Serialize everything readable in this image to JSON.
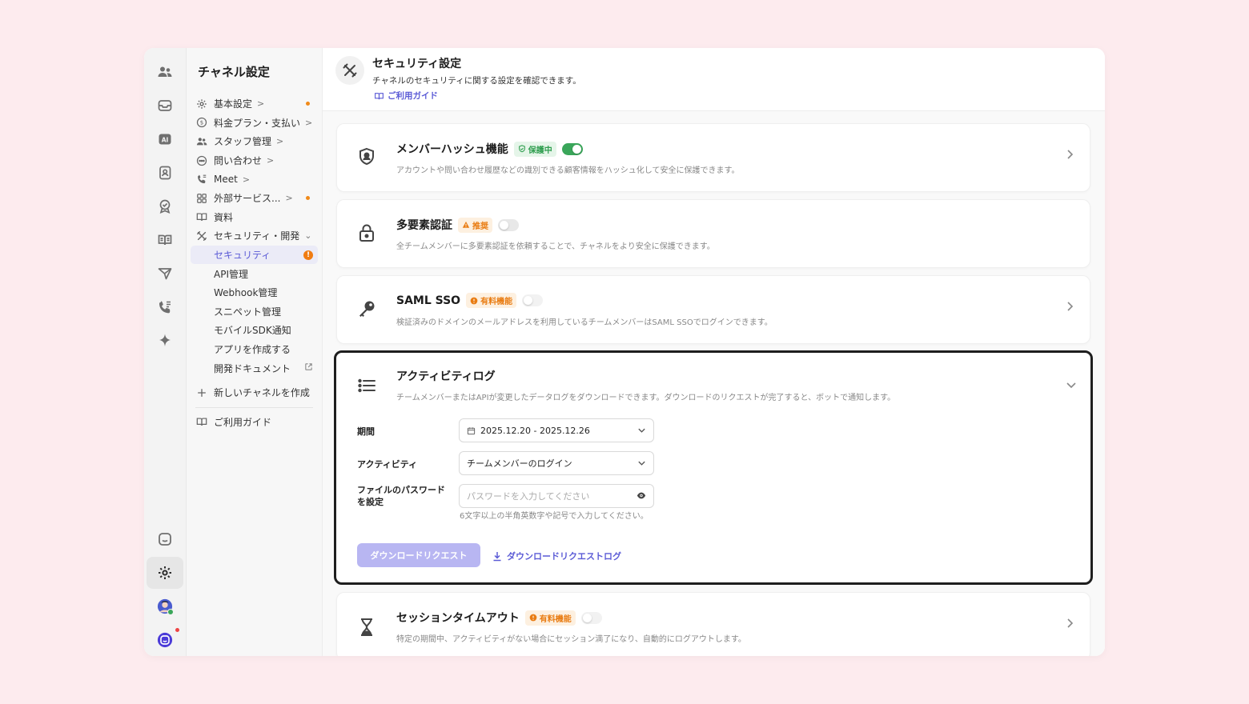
{
  "sidebar": {
    "title": "チャネル設定",
    "items": [
      {
        "label": "基本設定",
        "chevron": ">",
        "dot": true
      },
      {
        "label": "料金プラン・支払い",
        "chevron": ">"
      },
      {
        "label": "スタッフ管理",
        "chevron": ">"
      },
      {
        "label": "問い合わせ",
        "chevron": ">"
      },
      {
        "label": "Meet",
        "chevron": ">"
      },
      {
        "label": "外部サービス...",
        "chevron": ">",
        "dot": true
      },
      {
        "label": "資料"
      },
      {
        "label": "セキュリティ・開発",
        "chevron": "⌄"
      }
    ],
    "subitems": [
      {
        "label": "セキュリティ",
        "active": true,
        "warning": "!"
      },
      {
        "label": "API管理"
      },
      {
        "label": "Webhook管理"
      },
      {
        "label": "スニペット管理"
      },
      {
        "label": "モバイルSDK通知"
      },
      {
        "label": "アプリを作成する"
      },
      {
        "label": "開発ドキュメント"
      }
    ],
    "new_channel": "新しいチャネルを作成",
    "guide": "ご利用ガイド"
  },
  "header": {
    "title": "セキュリティ設定",
    "description": "チャネルのセキュリティに関する設定を確認できます。",
    "guide_link": "ご利用ガイド"
  },
  "cards": {
    "member_hash": {
      "title": "メンバーハッシュ機能",
      "badge": "保護中",
      "toggle": "on",
      "description": "アカウントや問い合わせ履歴などの識別できる顧客情報をハッシュ化して安全に保護できます。"
    },
    "mfa": {
      "title": "多要素認証",
      "badge": "推奨",
      "toggle": "off",
      "description": "全チームメンバーに多要素認証を依頼することで、チャネルをより安全に保護できます。"
    },
    "saml": {
      "title": "SAML SSO",
      "badge": "有料機能",
      "toggle": "disabled",
      "description": "検証済みのドメインのメールアドレスを利用しているチームメンバーはSAML SSOでログインできます。"
    },
    "activity_log": {
      "title": "アクティビティログ",
      "description": "チームメンバーまたはAPIが変更したデータログをダウンロードできます。ダウンロードのリクエストが完了すると、ボットで通知します。",
      "period_label": "期間",
      "period_value": "2025.12.20 - 2025.12.26",
      "activity_label": "アクティビティ",
      "activity_value": "チームメンバーのログイン",
      "password_label_line1": "ファイルのパスワード",
      "password_label_line2": "を設定",
      "password_placeholder": "パスワードを入力してください",
      "password_hint": "6文字以上の半角英数字や記号で入力してください。",
      "download_button": "ダウンロードリクエスト",
      "download_log_link": "ダウンロードリクエストログ"
    },
    "session_timeout": {
      "title": "セッションタイムアウト",
      "badge": "有料機能",
      "toggle": "disabled",
      "description": "特定の期間中、アクティビティがない場合にセッション満了になり、自動的にログアウトします。"
    }
  },
  "colors": {
    "accent": "#5b5bd6",
    "toggle_on": "#3aa65a",
    "badge_orange": "#e97c12",
    "badge_green": "#2f9e4f",
    "background": "#fdebee"
  }
}
